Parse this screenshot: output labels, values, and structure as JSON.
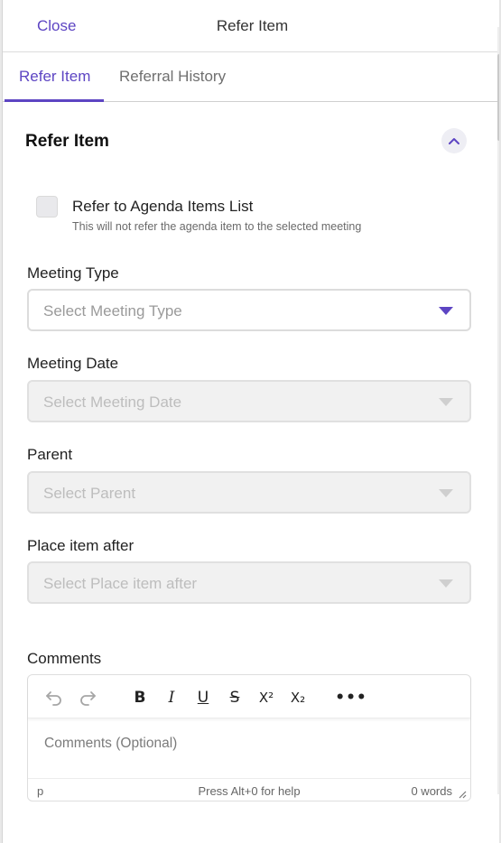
{
  "header": {
    "close_label": "Close",
    "title": "Refer Item"
  },
  "tabs": [
    {
      "label": "Refer Item",
      "active": true
    },
    {
      "label": "Referral History",
      "active": false
    }
  ],
  "section": {
    "title": "Refer Item",
    "collapse_icon": "chevron-up-icon"
  },
  "refer_checkbox": {
    "label": "Refer to Agenda Items List",
    "help": "This will not refer the agenda item to the selected meeting",
    "checked": false
  },
  "fields": {
    "meeting_type": {
      "label": "Meeting Type",
      "placeholder": "Select Meeting Type",
      "disabled": false
    },
    "meeting_date": {
      "label": "Meeting Date",
      "placeholder": "Select Meeting Date",
      "disabled": true
    },
    "parent": {
      "label": "Parent",
      "placeholder": "Select Parent",
      "disabled": true
    },
    "place_after": {
      "label": "Place item after",
      "placeholder": "Select Place item after",
      "disabled": true
    }
  },
  "comments": {
    "label": "Comments",
    "placeholder": "Comments (Optional)",
    "toolbar": [
      "undo-icon",
      "redo-icon",
      "bold-icon",
      "italic-icon",
      "underline-icon",
      "strikethrough-icon",
      "superscript-icon",
      "subscript-icon",
      "more-icon"
    ],
    "status_path": "p",
    "status_help": "Press Alt+0 for help",
    "word_count": "0 words"
  },
  "colors": {
    "accent": "#5d45c3",
    "disabled_bg": "#f1f1f1",
    "border": "#dcdcdc"
  }
}
